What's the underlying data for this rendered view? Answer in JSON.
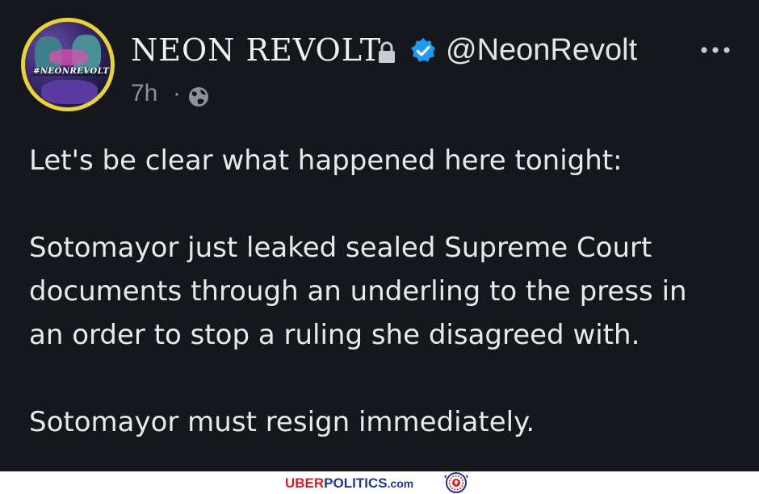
{
  "post": {
    "author_name": "NEON REVOLT",
    "handle": "@NeonRevolt",
    "time": "7h",
    "separator": "·",
    "avatar_tag": "#NEONREVOLT",
    "paragraphs": [
      [
        "Let's be clear what happened here tonight:"
      ],
      [
        "Sotomayor just leaked sealed Supreme Court",
        "documents through an underling to the press in",
        "an order to stop a ruling she disagreed with."
      ],
      [
        "Sotomayor must resign immediately."
      ]
    ],
    "icons": {
      "lock": "lock-icon",
      "verified": "verified-badge-icon",
      "more": "more-options-icon",
      "visibility": "globe-icon"
    },
    "colors": {
      "background": "#15171c",
      "verified": "#1d9bf0",
      "avatar_ring": "#e8d43a",
      "muted_text": "#8b9298"
    }
  },
  "footer": {
    "brand_uber": "UBER",
    "brand_politics": "POLITICS",
    "brand_com": ".com",
    "colors": {
      "uber": "#d11f27",
      "politics": "#1f3a8a"
    }
  }
}
